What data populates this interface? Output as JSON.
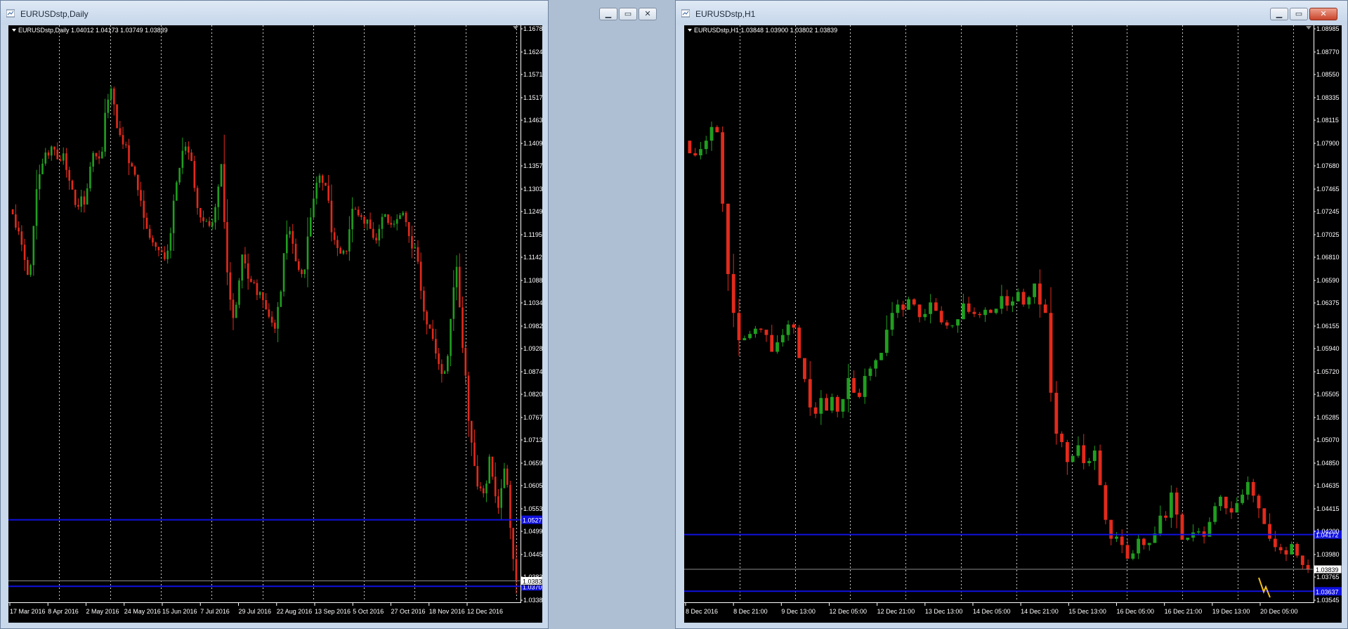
{
  "charts": [
    {
      "title": "EURUSDstp,Daily",
      "symbol_label": "EURUSDstp,Daily",
      "ohlc_text": "1.04012 1.04173 1.03749 1.03839",
      "x_labels": [
        "17 Mar 2016",
        "8 Apr 2016",
        "2 May 2016",
        "24 May 2016",
        "15 Jun 2016",
        "7 Jul 2016",
        "29 Jul 2016",
        "22 Aug 2016",
        "13 Sep 2016",
        "5 Oct 2016",
        "27 Oct 2016",
        "18 Nov 2016",
        "12 Dec 2016"
      ],
      "y_labels": [
        "1.16780",
        "1.16240",
        "1.15715",
        "1.15175",
        "1.14635",
        "1.14095",
        "1.13570",
        "1.13030",
        "1.12490",
        "1.11950",
        "1.11425",
        "1.10885",
        "1.10345",
        "1.09820",
        "1.09280",
        "1.08740",
        "1.08200",
        "1.07675",
        "1.07135",
        "1.06595",
        "1.06055",
        "1.05530",
        "1.04990",
        "1.04450",
        "1.03839",
        "1.03385"
      ],
      "price_range": [
        1.03385,
        1.1678
      ],
      "hlines": [
        1.0527,
        1.0371
      ],
      "hline_tags": [
        "1.05272",
        "1.03702"
      ],
      "bid": 1.03839,
      "bid_tag": "1.03839",
      "series": [
        1.1243,
        1.1212,
        1.1203,
        1.1172,
        1.1136,
        1.1101,
        1.1124,
        1.1216,
        1.1302,
        1.1337,
        1.1362,
        1.1388,
        1.1381,
        1.1402,
        1.1395,
        1.1372,
        1.1369,
        1.1386,
        1.1347,
        1.1322,
        1.1301,
        1.1265,
        1.1261,
        1.1285,
        1.1266,
        1.1304,
        1.1355,
        1.1387,
        1.1379,
        1.1374,
        1.139,
        1.1481,
        1.1512,
        1.1538,
        1.1501,
        1.1445,
        1.1429,
        1.1407,
        1.1405,
        1.1363,
        1.1355,
        1.1336,
        1.13,
        1.1275,
        1.1235,
        1.1209,
        1.1188,
        1.1177,
        1.1167,
        1.1159,
        1.1154,
        1.1138,
        1.1158,
        1.1199,
        1.1275,
        1.1318,
        1.1352,
        1.1392,
        1.1402,
        1.1388,
        1.1368,
        1.1305,
        1.1258,
        1.1236,
        1.1227,
        1.1227,
        1.1216,
        1.1224,
        1.126,
        1.1308,
        1.1361,
        1.1225,
        1.1107,
        1.1043,
        1.1,
        1.1031,
        1.1088,
        1.1149,
        1.1128,
        1.1092,
        1.1084,
        1.1082,
        1.1054,
        1.1061,
        1.1042,
        1.102,
        1.1003,
        1.0989,
        1.0975,
        1.1026,
        1.1062,
        1.1152,
        1.1196,
        1.1204,
        1.1174,
        1.1133,
        1.1113,
        1.1103,
        1.1114,
        1.1191,
        1.1236,
        1.128,
        1.1317,
        1.1334,
        1.1317,
        1.131,
        1.1275,
        1.1201,
        1.1183,
        1.1164,
        1.1151,
        1.1158,
        1.1156,
        1.1208,
        1.1256,
        1.1254,
        1.1241,
        1.1237,
        1.1221,
        1.1231,
        1.1209,
        1.1188,
        1.1182,
        1.1209,
        1.1237,
        1.1243,
        1.1223,
        1.1219,
        1.1221,
        1.1232,
        1.1241,
        1.1247,
        1.1225,
        1.1192,
        1.1163,
        1.1166,
        1.1132,
        1.1064,
        1.1015,
        1.0985,
        1.0975,
        1.0951,
        1.0917,
        1.0892,
        1.0869,
        1.0875,
        1.0911,
        1.0998,
        1.1072,
        1.112,
        1.1025,
        1.093,
        1.0865,
        1.0759,
        1.0708,
        1.0653,
        1.0605,
        1.0601,
        1.0589,
        1.0612,
        1.0675,
        1.0628,
        1.0582,
        1.0555,
        1.0601,
        1.0647,
        1.0609,
        1.0508,
        1.0435,
        1.0385
      ]
    },
    {
      "title": "EURUSDstp,H1",
      "symbol_label": "EURUSDstp,H1",
      "ohlc_text": "1.03848 1.03900 1.03802 1.03839",
      "x_labels": [
        "8 Dec 2016",
        "8 Dec 21:00",
        "9 Dec 13:00",
        "12 Dec 05:00",
        "12 Dec 21:00",
        "13 Dec 13:00",
        "14 Dec 05:00",
        "14 Dec 21:00",
        "15 Dec 13:00",
        "16 Dec 05:00",
        "16 Dec 21:00",
        "19 Dec 13:00",
        "20 Dec 05:00"
      ],
      "y_labels": [
        "1.08985",
        "1.08770",
        "1.08550",
        "1.08335",
        "1.08115",
        "1.07900",
        "1.07680",
        "1.07465",
        "1.07245",
        "1.07025",
        "1.06810",
        "1.06590",
        "1.06375",
        "1.06155",
        "1.05940",
        "1.05720",
        "1.05505",
        "1.05285",
        "1.05070",
        "1.04850",
        "1.04635",
        "1.04415",
        "1.04200",
        "1.03980",
        "1.03765",
        "1.03545"
      ],
      "price_range": [
        1.03545,
        1.08985
      ],
      "hlines": [
        1.0417,
        1.0363
      ],
      "hline_tags": [
        "1.04172",
        "1.03637"
      ],
      "bid": 1.03839,
      "bid_tag": "1.03839",
      "series": [
        1.078,
        1.0778,
        1.0784,
        1.0792,
        1.0805,
        1.08,
        1.0732,
        1.0665,
        1.0628,
        1.0602,
        1.0604,
        1.0608,
        1.0613,
        1.0612,
        1.0607,
        1.0591,
        1.06,
        1.0607,
        1.0617,
        1.0614,
        1.0585,
        1.0565,
        1.0538,
        1.0532,
        1.0547,
        1.0535,
        1.0548,
        1.0534,
        1.0546,
        1.0566,
        1.0552,
        1.0548,
        1.0568,
        1.0575,
        1.0583,
        1.059,
        1.0612,
        1.0628,
        1.0636,
        1.0631,
        1.0641,
        1.0636,
        1.0624,
        1.0627,
        1.0638,
        1.063,
        1.0619,
        1.0616,
        1.0616,
        1.0622,
        1.0637,
        1.0629,
        1.0627,
        1.0626,
        1.0631,
        1.0628,
        1.0632,
        1.0644,
        1.0635,
        1.0639,
        1.0648,
        1.0636,
        1.0643,
        1.0656,
        1.0636,
        1.0628,
        1.0552,
        1.0513,
        1.0505,
        1.0486,
        1.0492,
        1.0502,
        1.0485,
        1.0487,
        1.0497,
        1.0464,
        1.0431,
        1.0413,
        1.0415,
        1.0407,
        1.0394,
        1.0399,
        1.0413,
        1.0407,
        1.0409,
        1.0418,
        1.0435,
        1.0433,
        1.0457,
        1.0436,
        1.0412,
        1.0414,
        1.0419,
        1.042,
        1.0415,
        1.0429,
        1.0444,
        1.0453,
        1.0442,
        1.0438,
        1.0447,
        1.0455,
        1.0467,
        1.0454,
        1.0442,
        1.0427,
        1.0413,
        1.0405,
        1.0402,
        1.0398,
        1.0408,
        1.0397,
        1.0388,
        1.0384
      ]
    }
  ]
}
